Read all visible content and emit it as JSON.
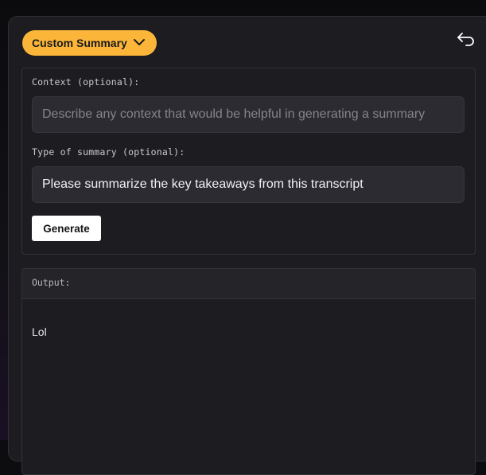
{
  "header": {
    "mode_label": "Custom Summary",
    "mode_icon": "chevron-down-icon",
    "back_icon": "undo-arrow-icon"
  },
  "form": {
    "context_label": "Context (optional):",
    "context_value": "",
    "context_placeholder": "Describe any context that would be helpful in generating a summary",
    "type_label": "Type of summary (optional):",
    "type_value": "Please summarize the key takeaways from this transcript",
    "generate_label": "Generate"
  },
  "output": {
    "label": "Output:",
    "text": "Lol"
  },
  "colors": {
    "accent": "#fbb63a",
    "panel_bg": "#1d1c21",
    "input_bg": "#2c2b31"
  }
}
